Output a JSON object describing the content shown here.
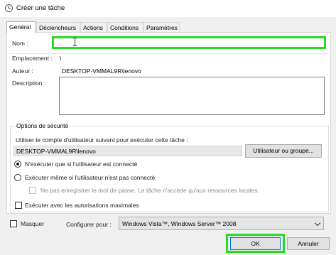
{
  "window": {
    "title": "Créer une tâche",
    "icon": "clock-icon"
  },
  "tabs": [
    {
      "label": "Général",
      "active": true
    },
    {
      "label": "Déclencheurs"
    },
    {
      "label": "Actions"
    },
    {
      "label": "Conditions"
    },
    {
      "label": "Paramètres"
    }
  ],
  "general": {
    "name_label": "Nom :",
    "name_value": "",
    "location_label": "Emplacement :",
    "location_value": "\\",
    "author_label": "Auteur :",
    "author_value": "DESKTOP-VMMAL9R\\lenovo",
    "description_label": "Description :",
    "description_value": ""
  },
  "security": {
    "group_title": "Options de sécurité",
    "account_prompt": "Utiliser le compte d'utilisateur suivant pour exécuter cette tâche :",
    "account_value": "DESKTOP-VMMAL9R\\lenovo",
    "change_user_button": "Utilisateur ou groupe...",
    "radio_logged_on": "N'exécuter que si l'utilisateur est connecté",
    "radio_whether_logged": "Exécuter même si l'utilisateur n'est pas connecté",
    "no_store_password": "Ne pas enregistrer le mot de passe. La tâche n'accède qu'aux ressources locales.",
    "highest_privileges": "Exécuter avec les autorisations maximales"
  },
  "footer": {
    "hidden_label": "Masquer",
    "configure_label": "Configurer pour :",
    "configure_value": "Windows Vista™, Windows Server™ 2008",
    "ok_button": "OK",
    "cancel_button": "Annuler"
  },
  "colors": {
    "highlight": "#22dd22"
  }
}
